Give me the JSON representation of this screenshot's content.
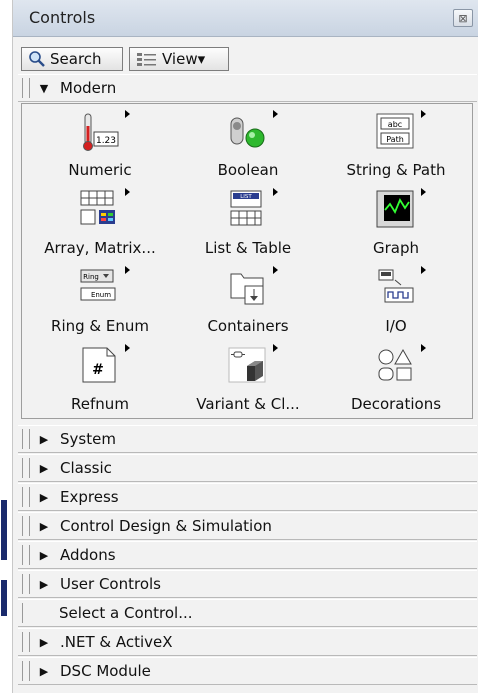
{
  "window": {
    "title": "Controls"
  },
  "toolbar": {
    "search_label": "Search",
    "view_label": "View▾"
  },
  "modern": {
    "label": "Modern",
    "items": [
      {
        "label": "Numeric",
        "icon": "numeric-icon"
      },
      {
        "label": "Boolean",
        "icon": "boolean-icon"
      },
      {
        "label": "String & Path",
        "icon": "string-path-icon"
      },
      {
        "label": "Array, Matrix...",
        "icon": "array-matrix-icon"
      },
      {
        "label": "List & Table",
        "icon": "list-table-icon"
      },
      {
        "label": "Graph",
        "icon": "graph-icon"
      },
      {
        "label": "Ring & Enum",
        "icon": "ring-enum-icon"
      },
      {
        "label": "Containers",
        "icon": "containers-icon"
      },
      {
        "label": "I/O",
        "icon": "io-icon"
      },
      {
        "label": "Refnum",
        "icon": "refnum-icon"
      },
      {
        "label": "Variant & Cl...",
        "icon": "variant-class-icon"
      },
      {
        "label": "Decorations",
        "icon": "decorations-icon"
      }
    ],
    "icon_text": {
      "numeric": "1.23",
      "string_top": "abc",
      "string_bottom": "Path",
      "list": "LIST",
      "ring": "Ring",
      "enum": "Enum",
      "refnum": "#"
    }
  },
  "sections": [
    {
      "label": "System"
    },
    {
      "label": "Classic"
    },
    {
      "label": "Express"
    },
    {
      "label": "Control Design & Simulation"
    },
    {
      "label": "Addons"
    },
    {
      "label": "User Controls"
    },
    {
      "label": "Select a Control..."
    },
    {
      "label": ".NET & ActiveX"
    },
    {
      "label": "DSC Module"
    }
  ]
}
